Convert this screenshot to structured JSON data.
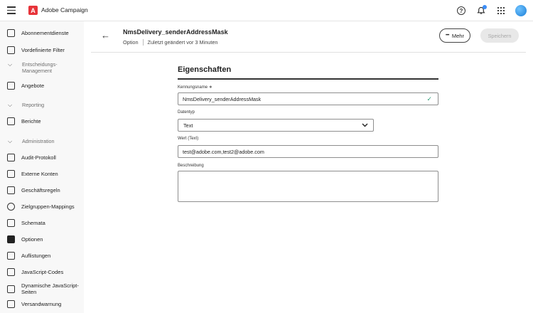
{
  "app": {
    "title": "Adobe Campaign",
    "logo_letter": "A",
    "brand_color": "#e7343a"
  },
  "sidebar": {
    "items": [
      {
        "label": "Abonnementdienste",
        "icon": "subscription-icon"
      },
      {
        "label": "Vordefinierte Filter",
        "icon": "filter-icon"
      },
      {
        "label": "Angebote",
        "icon": "offers-icon"
      },
      {
        "label": "Berichte",
        "icon": "reports-icon"
      },
      {
        "label": "Audit-Protokoll",
        "icon": "audit-icon"
      },
      {
        "label": "Externe Konten",
        "icon": "external-accounts-icon"
      },
      {
        "label": "Geschäftsregeln",
        "icon": "rules-icon"
      },
      {
        "label": "Zielgruppen-Mappings",
        "icon": "mapping-icon"
      },
      {
        "label": "Schemata",
        "icon": "schema-icon"
      },
      {
        "label": "Optionen",
        "icon": "options-icon"
      },
      {
        "label": "Auflistungen",
        "icon": "list-icon"
      },
      {
        "label": "JavaScript-Codes",
        "icon": "javascript-icon"
      },
      {
        "label": "Dynamische JavaScript-Seiten",
        "icon": "js-pages-icon"
      },
      {
        "label": "Versandwarnung",
        "icon": "warning-icon"
      }
    ],
    "sections": [
      {
        "label": "Entscheidungs-Management"
      },
      {
        "label": "Reporting"
      },
      {
        "label": "Administration"
      }
    ]
  },
  "header": {
    "back_glyph": "←",
    "title": "NmsDelivery_senderAddressMask",
    "type": "Option",
    "modified": "Zuletzt geändert vor 3 Minuten",
    "more_label": "Mehr",
    "more_glyph": "•••",
    "save_label": "Speichern"
  },
  "form": {
    "title": "Eigenschaften",
    "id_label": "Kennungsname",
    "required_mark": "∗",
    "id_value": "NmsDelivery_senderAddressMask",
    "check_glyph": "✓",
    "type_label": "Datentyp",
    "type_value": "Text",
    "value_label": "Wert (Text)",
    "value_value": "test@adobe.com,test2@adobe.com",
    "description_label": "Beschreibung",
    "description_value": ""
  }
}
